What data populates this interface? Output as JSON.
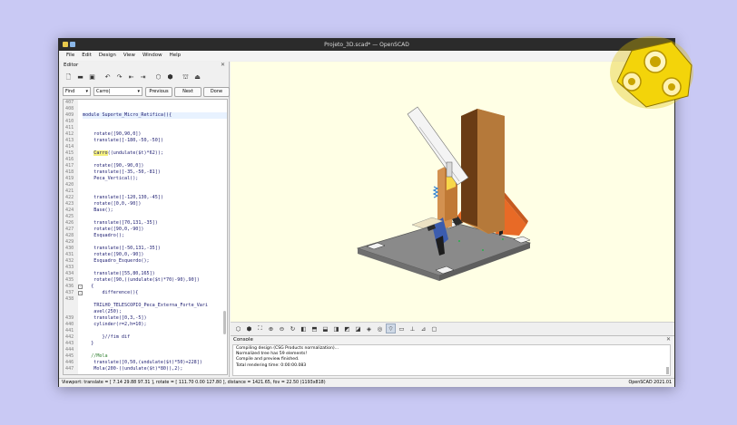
{
  "window": {
    "title": "Projeto_3D.scad* — OpenSCAD"
  },
  "menu": [
    "File",
    "Edit",
    "Design",
    "View",
    "Window",
    "Help"
  ],
  "editor": {
    "title": "Editor",
    "close": "✕",
    "toolbar_icons": [
      "new-file-icon",
      "open-file-icon",
      "save-file-icon",
      "undo-icon",
      "redo-icon",
      "unindent-icon",
      "indent-icon",
      "preview-icon",
      "render-icon",
      "export-stl-icon",
      "send-to-print-icon"
    ],
    "find": {
      "mode": "Find",
      "query": "Carro|",
      "previous": "Previous",
      "next": "Next",
      "done": "Done"
    },
    "lines": [
      {
        "n": "407",
        "code": ""
      },
      {
        "n": "408",
        "code": ""
      },
      {
        "n": "409",
        "code": "module Suporte_Micro_Retifica(){"
      },
      {
        "n": "410",
        "code": ""
      },
      {
        "n": "411",
        "code": ""
      },
      {
        "n": "412",
        "code": "    rotate([90,90,0])"
      },
      {
        "n": "413",
        "code": "    translate([-180,-50,-50])"
      },
      {
        "n": "414",
        "code": ""
      },
      {
        "n": "415",
        "code": "    Carro((undulate($t)*62));"
      },
      {
        "n": "416",
        "code": ""
      },
      {
        "n": "417",
        "code": "    rotate([90,-90,0])"
      },
      {
        "n": "418",
        "code": "    translate([-35,-50,-81])"
      },
      {
        "n": "419",
        "code": "    Peca_Vertical();"
      },
      {
        "n": "420",
        "code": ""
      },
      {
        "n": "421",
        "code": ""
      },
      {
        "n": "422",
        "code": "    translate([-120,130,-45])"
      },
      {
        "n": "423",
        "code": "    rotate([0,0,-90])"
      },
      {
        "n": "424",
        "code": "    Base();"
      },
      {
        "n": "425",
        "code": ""
      },
      {
        "n": "426",
        "code": "    translate([70,131,-35])"
      },
      {
        "n": "427",
        "code": "    rotate([90,0,-90])"
      },
      {
        "n": "428",
        "code": "    Esquadro();"
      },
      {
        "n": "429",
        "code": ""
      },
      {
        "n": "430",
        "code": "    translate([-50,131,-35])"
      },
      {
        "n": "431",
        "code": "    rotate([90,0,-90])"
      },
      {
        "n": "432",
        "code": "    Esquadro_Esquerdo();"
      },
      {
        "n": "433",
        "code": ""
      },
      {
        "n": "434",
        "code": "    translate([55,80,165])"
      },
      {
        "n": "435",
        "code": "    rotate([90,((undulate($t)*70)-90),90])"
      },
      {
        "n": "436",
        "code": "   {"
      },
      {
        "n": "437",
        "code": "       difference(){"
      },
      {
        "n": "438",
        "code": ""
      },
      {
        "n": "",
        "code": "    TRILHO_TELESCOPIO_Peca_Externa_Forte_Vari"
      },
      {
        "n": "",
        "code": "    avel(250);"
      },
      {
        "n": "439",
        "code": "    translate([0,3,-5])"
      },
      {
        "n": "440",
        "code": "    cylinder(r=2,h=10);"
      },
      {
        "n": "441",
        "code": ""
      },
      {
        "n": "442",
        "code": "       }//fim dif"
      },
      {
        "n": "443",
        "code": "   }"
      },
      {
        "n": "444",
        "code": ""
      },
      {
        "n": "445",
        "code": "   //Mola"
      },
      {
        "n": "446",
        "code": "    translate([0,50,(undulate($t)*50)+228])"
      },
      {
        "n": "447",
        "code": "    Mola(200-((undulate($t)*80)),2);"
      }
    ]
  },
  "view_toolbar_icons": [
    "preview-icon",
    "render-icon",
    "view-all-icon",
    "zoom-in-icon",
    "zoom-out-icon",
    "reset-view-icon",
    "view-right-icon",
    "view-top-icon",
    "view-bottom-icon",
    "view-left-icon",
    "view-front-icon",
    "view-back-icon",
    "view-diagonal-icon",
    "view-center-icon",
    "perspective-icon",
    "orthogonal-icon",
    "show-axes-icon",
    "show-scale-icon",
    "show-edges-icon"
  ],
  "console": {
    "title": "Console",
    "close": "✕",
    "lines": [
      "Compiling design (CSG Products normalization)...",
      "Normalized tree has 59 elements!",
      "Compile and preview finished.",
      "Total rendering time: 0:00:00.083"
    ]
  },
  "status": {
    "left": "Viewport: translate = [ 7.14 29.88 97.31 ], rotate = [ 111.70 0.00 127.80 ], distance = 1421.65, fov = 22.50 (1193x818)",
    "right": "OpenSCAD 2021.01"
  },
  "colors": {
    "background": "#c9c9f4",
    "viewport": "#ffffe5",
    "plank": "#c68a45",
    "bracket": "#e86a26",
    "base_plate": "#8c8c8c",
    "logo": "#f2d100"
  }
}
